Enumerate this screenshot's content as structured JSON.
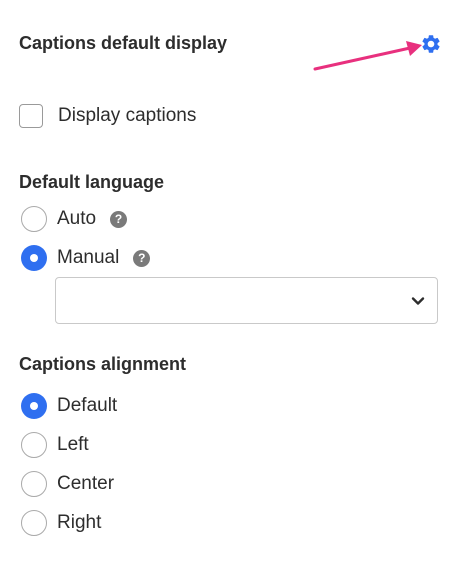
{
  "header": {
    "title": "Captions default display",
    "settings_icon": "gear-icon",
    "accent_color": "#2f6ff0",
    "arrow_color": "#e8307e"
  },
  "display_captions": {
    "label": "Display captions",
    "checked": false
  },
  "default_language": {
    "title": "Default language",
    "options": [
      {
        "label": "Auto",
        "selected": false,
        "help": "?"
      },
      {
        "label": "Manual",
        "selected": true,
        "help": "?"
      }
    ],
    "select": {
      "value": "",
      "icon": "chevron-down-icon"
    }
  },
  "captions_alignment": {
    "title": "Captions alignment",
    "options": [
      {
        "label": "Default",
        "selected": true
      },
      {
        "label": "Left",
        "selected": false
      },
      {
        "label": "Center",
        "selected": false
      },
      {
        "label": "Right",
        "selected": false
      }
    ]
  }
}
